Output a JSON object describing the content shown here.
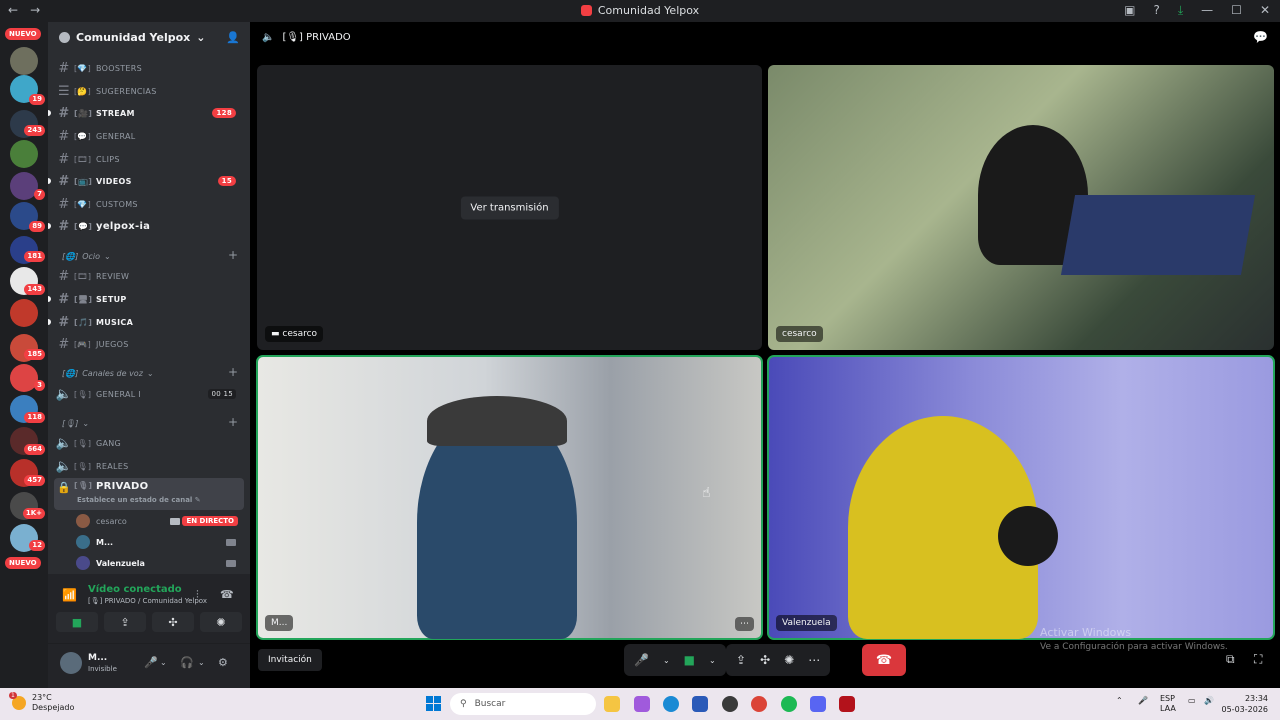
{
  "titlebar": {
    "title": "Comunidad Yelpox",
    "back": "←",
    "forward": "→"
  },
  "rail": {
    "new_top": "NUEVO",
    "new_bottom": "NUEVO",
    "badges": [
      "19",
      "243",
      "7",
      "89",
      "181",
      "143",
      "185",
      "3",
      "118",
      "664",
      "457",
      "1K+",
      "12"
    ]
  },
  "guild": {
    "name": "Comunidad Yelpox",
    "chevron": "⌄"
  },
  "channels": [
    {
      "emoji": "[💎]",
      "name": "BOOSTERS",
      "bold": false
    },
    {
      "emoji": "[🤔]",
      "name": "SUGERENCIAS",
      "bold": false
    },
    {
      "emoji": "[🎥]",
      "name": "STREAM",
      "bold": true,
      "count": "128"
    },
    {
      "emoji": "[💬]",
      "name": "GENERAL",
      "bold": false
    },
    {
      "emoji": "[🎞]",
      "name": "CLIPS",
      "bold": false
    },
    {
      "emoji": "[📺]",
      "name": "VIDEOS",
      "bold": true,
      "count": "15"
    },
    {
      "emoji": "[💎]",
      "name": "CUSTOMS",
      "bold": false
    },
    {
      "emoji": "[💬]",
      "name": "yelpox-ia",
      "bold": true
    }
  ],
  "categories": {
    "ocio": "Ocio",
    "canales_voz": "Canales de voz"
  },
  "ocio_channels": [
    {
      "emoji": "[🎞]",
      "name": "REVIEW",
      "bold": false
    },
    {
      "emoji": "[🖥]",
      "name": "SETUP",
      "bold": true
    },
    {
      "emoji": "[🎵]",
      "name": "MUSICA",
      "bold": true
    },
    {
      "emoji": "[🎮]",
      "name": "JUEGOS",
      "bold": false
    }
  ],
  "voice_channels": {
    "general": {
      "emoji": "[🎙]",
      "name": "GENERAL I",
      "count_a": "00",
      "count_b": "15"
    },
    "gang": {
      "emoji": "[🎙]",
      "name": "GANG"
    },
    "reales": {
      "emoji": "[🎙]",
      "name": "REALES"
    },
    "privado": {
      "emoji": "[🎙]",
      "name": "PRIVADO",
      "sub": "Establece un estado de canal ✎"
    }
  },
  "voice_users": [
    {
      "name": "cesarco",
      "live": "EN DIRECTO",
      "color": "#8a5a44"
    },
    {
      "name": "M...",
      "color": "#3a6e8a"
    },
    {
      "name": "Valenzuela",
      "color": "#4a4a8a"
    }
  ],
  "voice_panel": {
    "status": "Vídeo conectado",
    "location": "[🎙] PRIVADO / Comunidad Yelpox"
  },
  "user_panel": {
    "name": "M...",
    "status": "Invisible"
  },
  "call": {
    "channel": "[🎙] PRIVADO",
    "watch_label": "Ver transmisión",
    "tiles": [
      {
        "label": "cesarco",
        "type": "stream"
      },
      {
        "label": "cesarco",
        "type": "camera"
      },
      {
        "label": "M...",
        "type": "camera"
      },
      {
        "label": "Valenzuela",
        "type": "camera"
      }
    ],
    "invite": "Invitación",
    "more": "⋯"
  },
  "watermark": {
    "line1": "Activar Windows",
    "line2": "Ve a Configuración para activar Windows."
  },
  "taskbar": {
    "temp": "23°C",
    "weather": "Despejado",
    "weather_badge": "1",
    "search": "Buscar",
    "lang1": "ESP",
    "lang2": "LAA",
    "time": "23:34",
    "date": "05-03-2026"
  }
}
